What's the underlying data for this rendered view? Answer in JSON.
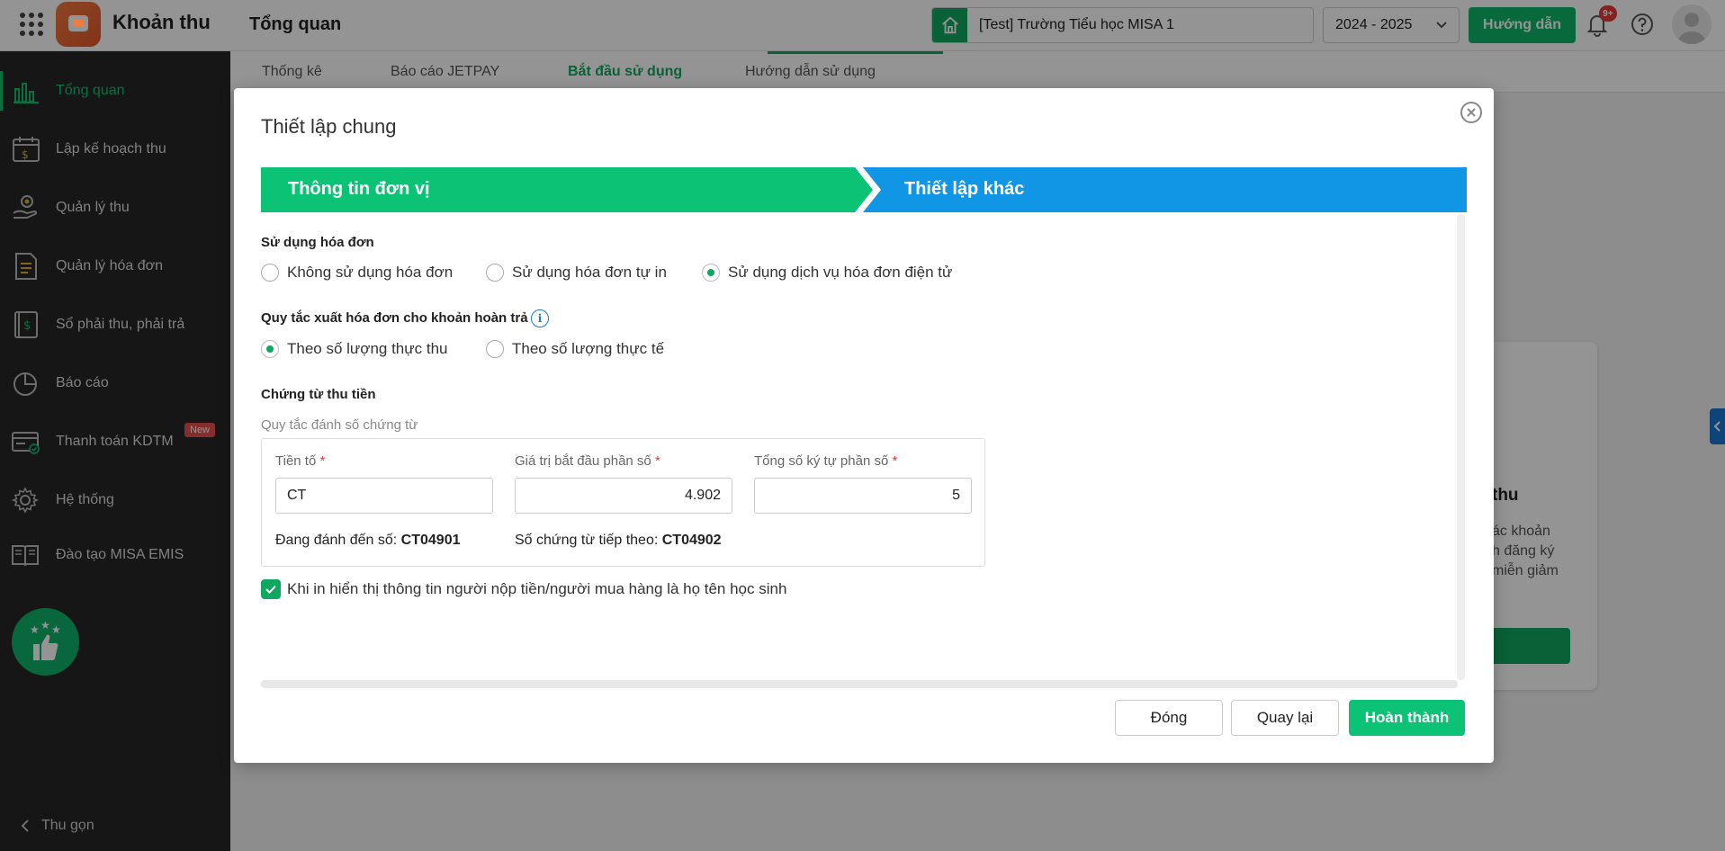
{
  "app": {
    "title": "Khoản thu",
    "page_title": "Tổng quan",
    "school": "[Test] Trường Tiểu học MISA 1",
    "year": "2024 - 2025",
    "guide_label": "Hướng dẫn",
    "notification_badge": "9+",
    "accent_color": "#0cc275"
  },
  "sidebar": {
    "items": [
      {
        "label": "Tổng quan",
        "icon": "bar-chart-icon",
        "active": true
      },
      {
        "label": "Lập kế hoạch thu",
        "icon": "calendar-money-icon"
      },
      {
        "label": "Quản lý thu",
        "icon": "hand-coin-icon"
      },
      {
        "label": "Quản lý hóa đơn",
        "icon": "invoice-icon"
      },
      {
        "label": "Sổ phải thu, phải trả",
        "icon": "ledger-icon"
      },
      {
        "label": "Báo cáo",
        "icon": "pie-chart-icon"
      },
      {
        "label": "Thanh toán KDTM",
        "icon": "card-icon",
        "badge": "New"
      },
      {
        "label": "Hệ thống",
        "icon": "gear-icon"
      },
      {
        "label": "Đào tạo MISA EMIS",
        "icon": "book-icon"
      }
    ],
    "collapse_label": "Thu gọn"
  },
  "tabs": [
    "Thống kê",
    "Báo cáo JETPAY",
    "Bắt đầu sử dụng",
    "Hướng dẫn sử dụng"
  ],
  "background_card": {
    "title": "thu",
    "text": "ác khoản\nh đăng ký\nmiễn giảm"
  },
  "modal": {
    "title": "Thiết lập chung",
    "steps": [
      "Thông tin đơn vị",
      "Thiết lập khác"
    ],
    "invoice_section": {
      "title": "Sử dụng hóa đơn",
      "options": [
        "Không sử dụng hóa đơn",
        "Sử dụng hóa đơn tự in",
        "Sử dụng dịch vụ hóa đơn điện tử"
      ],
      "selected": 2
    },
    "refund_section": {
      "title": "Quy tắc xuất hóa đơn cho khoản hoàn trả",
      "options": [
        "Theo số lượng thực thu",
        "Theo số lượng thực tế"
      ],
      "selected": 0
    },
    "receipt_section": {
      "title": "Chứng từ thu tiền",
      "caption": "Quy tắc đánh số chứng từ",
      "prefix_label": "Tiền tố",
      "prefix_value": "CT",
      "start_label": "Giá trị bắt đầu phần số",
      "start_value": "4.902",
      "digits_label": "Tổng số ký tự phần số",
      "digits_value": "5",
      "current_label": "Đang đánh đến số:",
      "current_value": "CT04901",
      "next_label": "Số chứng từ tiếp theo:",
      "next_value": "CT04902"
    },
    "checkbox_label": "Khi in hiển thị thông tin người nộp tiền/người mua hàng là họ tên học sinh",
    "buttons": {
      "close": "Đóng",
      "back": "Quay lại",
      "finish": "Hoàn thành"
    }
  }
}
